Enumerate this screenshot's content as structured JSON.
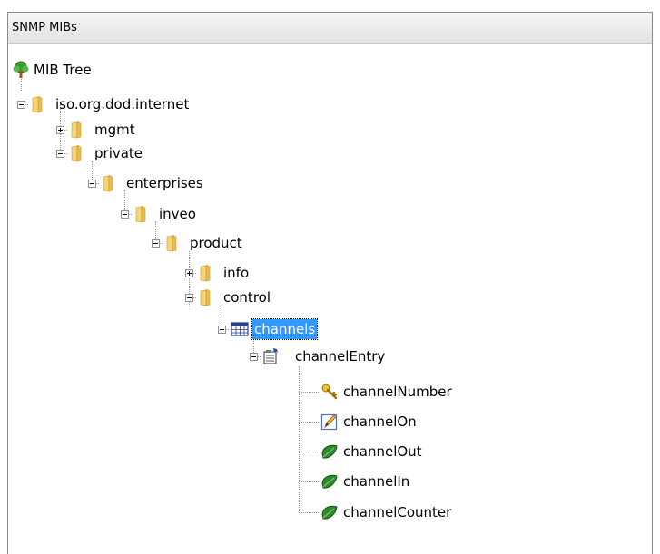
{
  "panel": {
    "title": "SNMP MIBs"
  },
  "tree": {
    "root": "MIB Tree",
    "internet": "iso.org.dod.internet",
    "mgmt": "mgmt",
    "private": "private",
    "enterprises": "enterprises",
    "inveo": "inveo",
    "product": "product",
    "info": "info",
    "control": "control",
    "channels": "channels",
    "channelEntry": "channelEntry",
    "channelNumber": "channelNumber",
    "channelOn": "channelOn",
    "channelOut": "channelOut",
    "channelIn": "channelIn",
    "channelCounter": "channelCounter"
  },
  "icons": {
    "root": "tree-icon",
    "folder": "folder-icon",
    "table": "table-icon",
    "entry": "table-entry-icon",
    "key": "key-icon",
    "writable": "pencil-edit-icon",
    "leaf": "leaf-icon"
  },
  "colors": {
    "selection": "#3399ff",
    "folder": "#e8c25a",
    "leaf": "#1f7a1f"
  }
}
